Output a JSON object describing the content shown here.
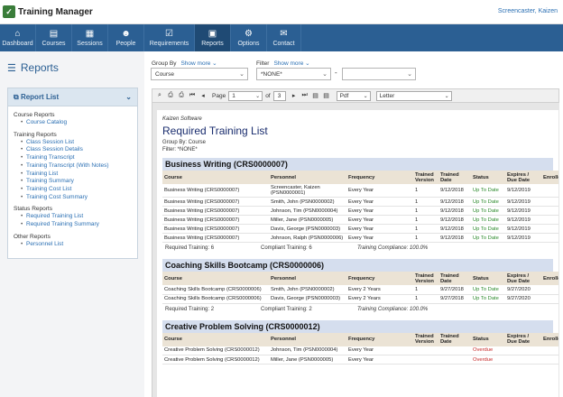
{
  "app": {
    "title": "Training Manager",
    "user": "Screencaster, Kaizen"
  },
  "nav": [
    {
      "label": "Dashboard",
      "icon": "⌂"
    },
    {
      "label": "Courses",
      "icon": "▤"
    },
    {
      "label": "Sessions",
      "icon": "▦"
    },
    {
      "label": "People",
      "icon": "☻"
    },
    {
      "label": "Requirements",
      "icon": "☑"
    },
    {
      "label": "Reports",
      "icon": "▣"
    },
    {
      "label": "Options",
      "icon": "⚙"
    },
    {
      "label": "Contact",
      "icon": "✉"
    }
  ],
  "page": {
    "title": "Reports"
  },
  "report_list": {
    "title": "Report List",
    "groups": [
      {
        "title": "Course Reports",
        "items": [
          "Course Catalog"
        ]
      },
      {
        "title": "Training Reports",
        "items": [
          "Class Session List",
          "Class Session Details",
          "Training Transcript",
          "Training Transcript (With Notes)",
          "Training List",
          "Training Summary",
          "Training Cost List",
          "Training Cost Summary"
        ]
      },
      {
        "title": "Status Reports",
        "items": [
          "Required Training List",
          "Required Training Summary"
        ]
      },
      {
        "title": "Other Reports",
        "items": [
          "Personnel List"
        ]
      }
    ]
  },
  "filters": {
    "group_by_label": "Group By",
    "group_by_link": "Show more ⌄",
    "group_by_value": "Course",
    "filter_label": "Filter",
    "filter_link": "Show more ⌄",
    "filter_value": "*NONE*",
    "filter_value2": "",
    "dash": "-"
  },
  "toolbar": {
    "page_label": "Page",
    "page_value": "1",
    "of_label": "of",
    "page_total": "3",
    "format_value": "Pdf",
    "paper_value": "Letter"
  },
  "report": {
    "company": "Kaizen Software",
    "title": "Required Training List",
    "group_by": "Group By: Course",
    "filter": "Filter: *NONE*",
    "columns": [
      "Course",
      "Personnel",
      "Frequency",
      "Trained Version",
      "Trained Date",
      "Status",
      "Expires / Due Date",
      "Enrolled"
    ],
    "sections": [
      {
        "course": "Business Writing (CRS0000007)",
        "rows": [
          [
            "Business Writing (CRS0000007)",
            "Screencaster, Kaizen (PSN0000001)",
            "Every Year",
            "1",
            "9/12/2018",
            "Up To Date",
            "9/12/2019",
            ""
          ],
          [
            "Business Writing (CRS0000007)",
            "Smith, John (PSN0000002)",
            "Every Year",
            "1",
            "9/12/2018",
            "Up To Date",
            "9/12/2019",
            ""
          ],
          [
            "Business Writing (CRS0000007)",
            "Johnson, Tim (PSN0000004)",
            "Every Year",
            "1",
            "9/12/2018",
            "Up To Date",
            "9/12/2019",
            ""
          ],
          [
            "Business Writing (CRS0000007)",
            "Miller, Jane (PSN0000005)",
            "Every Year",
            "1",
            "9/12/2018",
            "Up To Date",
            "9/12/2019",
            ""
          ],
          [
            "Business Writing (CRS0000007)",
            "Davis, George (PSN0000003)",
            "Every Year",
            "1",
            "9/12/2018",
            "Up To Date",
            "9/12/2019",
            ""
          ],
          [
            "Business Writing (CRS0000007)",
            "Johnson, Ralph (PSN0000006)",
            "Every Year",
            "1",
            "9/12/2018",
            "Up To Date",
            "9/12/2019",
            ""
          ]
        ],
        "summary": {
          "required": "Required Training:   6",
          "compliant": "Compliant Training:   6",
          "compliance": "Training Compliance:  100.0%"
        }
      },
      {
        "course": "Coaching Skills Bootcamp (CRS0000006)",
        "rows": [
          [
            "Coaching Skills Bootcamp (CRS0000006)",
            "Smith, John (PSN0000002)",
            "Every 2 Years",
            "1",
            "9/27/2018",
            "Up To Date",
            "9/27/2020",
            ""
          ],
          [
            "Coaching Skills Bootcamp (CRS0000006)",
            "Davis, George (PSN0000003)",
            "Every 2 Years",
            "1",
            "9/27/2018",
            "Up To Date",
            "9/27/2020",
            ""
          ]
        ],
        "summary": {
          "required": "Required Training:   2",
          "compliant": "Compliant Training:   2",
          "compliance": "Training Compliance:  100.0%"
        }
      },
      {
        "course": "Creative Problem Solving (CRS0000012)",
        "rows": [
          [
            "Creative Problem Solving (CRS0000012)",
            "Johnson, Tim (PSN0000004)",
            "Every Year",
            "",
            "",
            "Overdue",
            "",
            ""
          ],
          [
            "Creative Problem Solving (CRS0000012)",
            "Miller, Jane (PSN0000005)",
            "Every Year",
            "",
            "",
            "Overdue",
            "",
            ""
          ]
        ]
      }
    ]
  },
  "colors": {
    "nav_bg": "#2b5f93",
    "up_to_date": "#2c8a2c",
    "overdue": "#c62828",
    "course_band": "#d5deee",
    "header_band": "#ebe3d5"
  }
}
